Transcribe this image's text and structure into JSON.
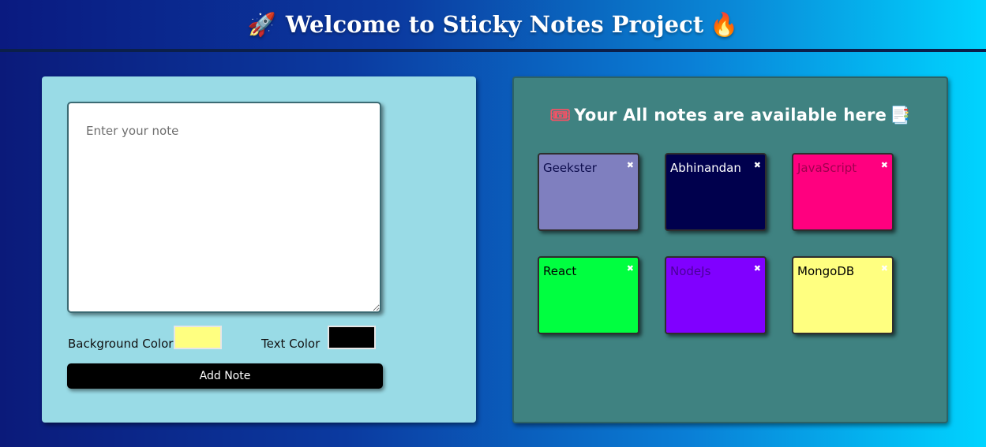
{
  "header": {
    "title": "Welcome to Sticky Notes Project",
    "leading_icon": "🚀",
    "trailing_icon": "🔥"
  },
  "editor": {
    "placeholder": "Enter your note",
    "background_color_label": "Background Color",
    "text_color_label": "Text Color",
    "background_color_value": "#ffff80",
    "text_color_value": "#000000",
    "add_button_label": "Add Note"
  },
  "notes_panel": {
    "heading": "Your All notes are available here",
    "leading_icon": "🎟",
    "trailing_icon": "📑",
    "notes": [
      {
        "text": "Geekster",
        "bg": "#7f7fbf",
        "color": "#0d0d4d",
        "close": "✖"
      },
      {
        "text": "Abhinandan",
        "bg": "#00004d",
        "color": "#ffffff",
        "close": "✖"
      },
      {
        "text": "JavaScript",
        "bg": "#ff007f",
        "color": "#a0004f",
        "close": "✖"
      },
      {
        "text": "React",
        "bg": "#00ff40",
        "color": "#000000",
        "close": "✖"
      },
      {
        "text": "NodeJs",
        "bg": "#8000ff",
        "color": "#4a0099",
        "close": "✖"
      },
      {
        "text": "MongoDB",
        "bg": "#ffff80",
        "color": "#000000",
        "close": "✖"
      }
    ]
  }
}
